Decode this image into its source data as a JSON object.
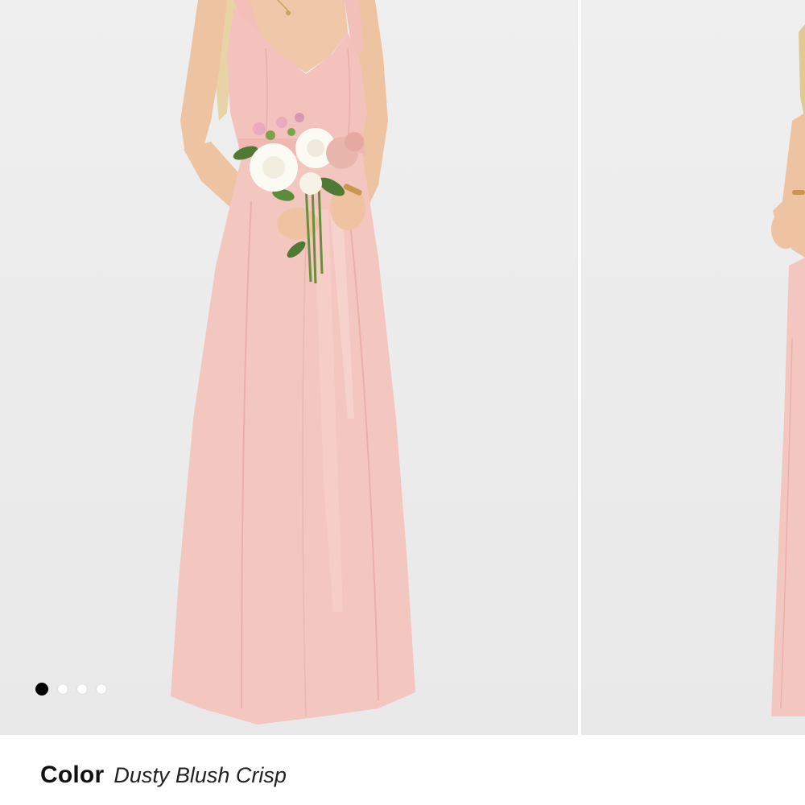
{
  "gallery": {
    "slides": [
      {
        "image_icon": "model-in-dusty-blush-gown-holding-bouquet-icon"
      },
      {
        "image_icon": "model-in-dusty-blush-gown-side-view-icon"
      }
    ],
    "pagination": {
      "total": 4,
      "active_index": 0
    }
  },
  "colors": {
    "background": "#ebebeb",
    "dress": "#f3c2bd",
    "active_dot": "#000000",
    "inactive_dot": "#ffffff"
  },
  "product": {
    "color_label": "Color",
    "color_value": "Dusty Blush Crisp"
  }
}
